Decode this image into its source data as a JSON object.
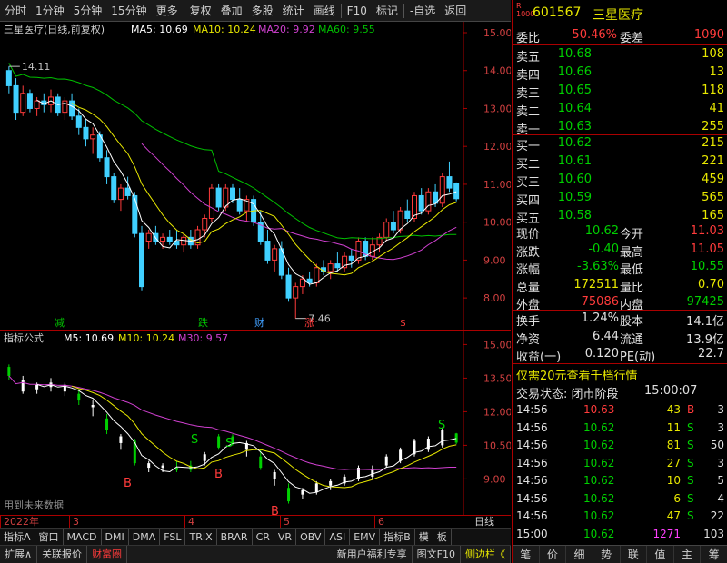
{
  "toolbar": {
    "items": [
      "分时",
      "1分钟",
      "5分钟",
      "15分钟",
      "更多",
      "复权",
      "叠加",
      "多股",
      "统计",
      "画线",
      "F10",
      "标记",
      "-自选",
      "返回"
    ]
  },
  "main_chart": {
    "legend": {
      "title": "三星医疗(日线,前复权)",
      "ma5": "MA5: 10.69",
      "ma10": "MA10: 10.24",
      "ma20": "MA20: 9.92",
      "ma60": "MA60: 9.55"
    },
    "annotations": {
      "high": "14.11",
      "low": "7.46",
      "m1": "减",
      "m2": "跌",
      "m3": "财",
      "m4": "涨",
      "m5": "$"
    }
  },
  "indicator_chart": {
    "legend": {
      "title": "指标公式",
      "m5": "M5: 10.69",
      "m10": "M10: 10.24",
      "m30": "M30: 9.57"
    },
    "note": "用到未来数据",
    "signal_s": "S",
    "signal_b": "B"
  },
  "date_axis": {
    "labels": [
      "2022年",
      "3",
      "4",
      "5",
      "6"
    ],
    "right_label": "日线"
  },
  "indicator_tabs": [
    "指标A",
    "窗口",
    "MACD",
    "DMI",
    "DMA",
    "FSL",
    "TRIX",
    "BRAR",
    "CR",
    "VR",
    "OBV",
    "ASI",
    "EMV",
    "指标B",
    "模",
    "板"
  ],
  "bottom_bar": {
    "items": [
      "扩展∧",
      "关联报价",
      "财富圈"
    ],
    "right_items": [
      "新用户福利专享",
      "图文F10",
      "侧边栏《"
    ]
  },
  "quote": {
    "badge_top": "R",
    "badge_bottom": "1000",
    "code": "601567",
    "name": "三星医疗",
    "webi_label": "委比",
    "webi_value": "50.46%",
    "weicha_label": "委差",
    "weicha_value": "1090",
    "asks": [
      {
        "label": "卖五",
        "price": "10.68",
        "vol": "108"
      },
      {
        "label": "卖四",
        "price": "10.66",
        "vol": "13"
      },
      {
        "label": "卖三",
        "price": "10.65",
        "vol": "118"
      },
      {
        "label": "卖二",
        "price": "10.64",
        "vol": "41"
      },
      {
        "label": "卖一",
        "price": "10.63",
        "vol": "255"
      }
    ],
    "bids": [
      {
        "label": "买一",
        "price": "10.62",
        "vol": "215"
      },
      {
        "label": "买二",
        "price": "10.61",
        "vol": "221"
      },
      {
        "label": "买三",
        "price": "10.60",
        "vol": "459"
      },
      {
        "label": "买四",
        "price": "10.59",
        "vol": "565"
      },
      {
        "label": "买五",
        "price": "10.58",
        "vol": "165"
      }
    ],
    "stats": [
      {
        "l1": "现价",
        "v1": "10.62",
        "l2": "今开",
        "v2": "11.03"
      },
      {
        "l1": "涨跌",
        "v1": "-0.40",
        "l2": "最高",
        "v2": "11.05"
      },
      {
        "l1": "涨幅",
        "v1": "-3.63%",
        "l2": "最低",
        "v2": "10.55"
      },
      {
        "l1": "总量",
        "v1": "172511",
        "l2": "量比",
        "v2": "0.70"
      },
      {
        "l1": "外盘",
        "v1": "75086",
        "l2": "内盘",
        "v2": "97425"
      }
    ],
    "stats2": [
      {
        "l1": "换手",
        "v1": "1.24%",
        "l2": "股本",
        "v2": "14.1亿"
      },
      {
        "l1": "净资",
        "v1": "6.44",
        "l2": "流通",
        "v2": "13.9亿"
      },
      {
        "l1": "收益(一)",
        "v1": "0.120",
        "l2": "PE(动)",
        "v2": "22.7"
      }
    ],
    "promo": "仅需20元查看千档行情",
    "status_label": "交易状态: 闭市阶段",
    "status_time": "15:00:07",
    "ticks": [
      {
        "t": "14:56",
        "p": "10.63",
        "v": "43",
        "d": "B",
        "n": "3"
      },
      {
        "t": "14:56",
        "p": "10.62",
        "v": "11",
        "d": "S",
        "n": "3"
      },
      {
        "t": "14:56",
        "p": "10.62",
        "v": "81",
        "d": "S",
        "n": "50"
      },
      {
        "t": "14:56",
        "p": "10.62",
        "v": "27",
        "d": "S",
        "n": "3"
      },
      {
        "t": "14:56",
        "p": "10.62",
        "v": "10",
        "d": "S",
        "n": "5"
      },
      {
        "t": "14:56",
        "p": "10.62",
        "v": "6",
        "d": "S",
        "n": "4"
      },
      {
        "t": "14:56",
        "p": "10.62",
        "v": "47",
        "d": "S",
        "n": "22"
      },
      {
        "t": "15:00",
        "p": "10.62",
        "v": "1271",
        "d": "",
        "n": "103"
      }
    ],
    "nav": [
      "笔",
      "价",
      "细",
      "势",
      "联",
      "值",
      "主",
      "筹"
    ]
  },
  "chart_data": {
    "type": "candlestick",
    "y_axis_main": {
      "ticks": [
        "15.00",
        "14.00",
        "13.00",
        "12.00",
        "11.00",
        "10.00",
        "9.00",
        "8.00"
      ],
      "range": [
        7.5,
        15.0
      ]
    },
    "y_axis_indicator": {
      "ticks": [
        "15.00",
        "13.50",
        "12.00",
        "10.50",
        "9.00"
      ],
      "range": [
        7.8,
        15.3
      ]
    },
    "candles": [
      [
        14.0,
        14.11,
        13.4,
        13.6
      ],
      [
        13.6,
        13.8,
        12.7,
        12.9
      ],
      [
        12.9,
        13.6,
        12.8,
        13.4
      ],
      [
        13.4,
        13.5,
        12.9,
        13.0
      ],
      [
        13.0,
        13.3,
        12.8,
        13.2
      ],
      [
        13.2,
        13.4,
        12.9,
        13.1
      ],
      [
        13.1,
        13.5,
        12.9,
        13.3
      ],
      [
        13.3,
        13.4,
        12.8,
        12.9
      ],
      [
        12.9,
        13.3,
        12.7,
        13.2
      ],
      [
        13.2,
        13.4,
        12.7,
        12.8
      ],
      [
        12.8,
        13.0,
        12.3,
        12.5
      ],
      [
        12.5,
        12.7,
        12.0,
        12.2
      ],
      [
        12.2,
        12.5,
        11.8,
        12.3
      ],
      [
        12.3,
        12.4,
        11.6,
        11.7
      ],
      [
        11.7,
        11.9,
        11.0,
        11.2
      ],
      [
        11.2,
        11.3,
        10.5,
        10.6
      ],
      [
        10.6,
        11.0,
        10.3,
        10.9
      ],
      [
        10.9,
        11.2,
        10.6,
        10.7
      ],
      [
        10.7,
        10.8,
        9.6,
        9.7
      ],
      [
        9.7,
        9.9,
        8.2,
        8.3
      ],
      [
        9.5,
        9.8,
        9.3,
        9.7
      ],
      [
        9.7,
        9.9,
        9.4,
        9.5
      ],
      [
        9.5,
        9.7,
        9.3,
        9.6
      ],
      [
        9.6,
        9.8,
        9.4,
        9.5
      ],
      [
        9.5,
        9.8,
        9.3,
        9.4
      ],
      [
        9.4,
        9.7,
        9.2,
        9.6
      ],
      [
        9.6,
        9.8,
        9.3,
        9.4
      ],
      [
        9.4,
        9.9,
        9.3,
        9.8
      ],
      [
        9.8,
        10.2,
        9.6,
        10.1
      ],
      [
        10.1,
        11.0,
        10.0,
        10.9
      ],
      [
        10.9,
        11.0,
        10.3,
        10.4
      ],
      [
        10.4,
        11.0,
        10.3,
        10.9
      ],
      [
        10.9,
        11.0,
        10.5,
        10.6
      ],
      [
        10.6,
        10.9,
        10.2,
        10.3
      ],
      [
        10.3,
        10.7,
        10.0,
        10.6
      ],
      [
        10.6,
        10.7,
        9.9,
        10.0
      ],
      [
        10.0,
        10.3,
        9.4,
        9.5
      ],
      [
        9.5,
        9.8,
        8.9,
        9.0
      ],
      [
        9.0,
        9.4,
        8.7,
        9.3
      ],
      [
        9.3,
        9.5,
        8.5,
        8.6
      ],
      [
        8.6,
        8.8,
        7.9,
        8.0
      ],
      [
        8.0,
        8.4,
        7.46,
        8.3
      ],
      [
        8.3,
        8.6,
        8.1,
        8.5
      ],
      [
        8.5,
        8.7,
        8.3,
        8.4
      ],
      [
        8.4,
        8.9,
        8.3,
        8.8
      ],
      [
        8.8,
        9.0,
        8.6,
        8.7
      ],
      [
        8.7,
        9.0,
        8.5,
        8.9
      ],
      [
        8.9,
        9.2,
        8.7,
        8.8
      ],
      [
        8.8,
        9.2,
        8.7,
        9.1
      ],
      [
        9.1,
        9.3,
        8.8,
        9.0
      ],
      [
        9.0,
        9.6,
        8.9,
        9.5
      ],
      [
        9.5,
        9.6,
        9.0,
        9.1
      ],
      [
        9.1,
        9.6,
        9.0,
        9.4
      ],
      [
        9.4,
        9.7,
        9.2,
        9.6
      ],
      [
        9.6,
        10.1,
        9.5,
        10.0
      ],
      [
        10.0,
        10.3,
        9.7,
        9.8
      ],
      [
        9.8,
        10.4,
        9.7,
        10.3
      ],
      [
        10.3,
        10.6,
        10.0,
        10.1
      ],
      [
        10.1,
        10.8,
        10.0,
        10.7
      ],
      [
        10.7,
        10.9,
        10.2,
        10.3
      ],
      [
        10.3,
        10.9,
        10.2,
        10.8
      ],
      [
        10.8,
        11.0,
        10.4,
        10.5
      ],
      [
        10.5,
        11.3,
        10.4,
        11.2
      ],
      [
        11.2,
        11.6,
        10.8,
        10.9
      ],
      [
        11.03,
        11.05,
        10.55,
        10.62
      ]
    ]
  }
}
